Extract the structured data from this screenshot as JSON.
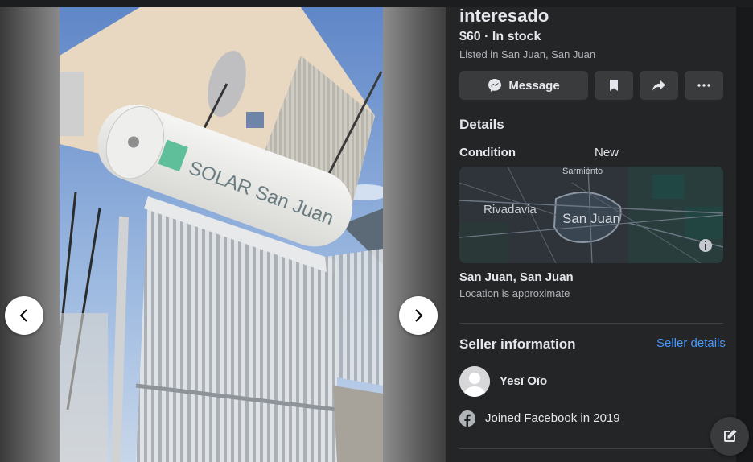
{
  "listing": {
    "title": "interesado",
    "price_line": "$60 · In stock",
    "listed_in": "Listed in San Juan, San Juan"
  },
  "actions": {
    "message_label": "Message",
    "icons": [
      "messenger-icon",
      "bookmark-icon",
      "share-icon",
      "more-icon"
    ]
  },
  "details": {
    "heading": "Details",
    "condition_label": "Condition",
    "condition_value": "New"
  },
  "map": {
    "labels": {
      "north": "Sarmiento",
      "west": "Rivadavia",
      "center": "San Juan"
    }
  },
  "location": {
    "name": "San Juan, San Juan",
    "note": "Location is approximate"
  },
  "seller": {
    "heading": "Seller information",
    "details_link": "Seller details",
    "name": "Yesï Oïo",
    "joined": "Joined Facebook in 2019"
  },
  "photo": {
    "sign_text": "SOLAR San Juan"
  },
  "colors": {
    "panel_bg": "#242526",
    "button_bg": "#3a3b3c",
    "link": "#4599ff",
    "text_primary": "#e4e6eb",
    "text_secondary": "#b0b3b8"
  }
}
